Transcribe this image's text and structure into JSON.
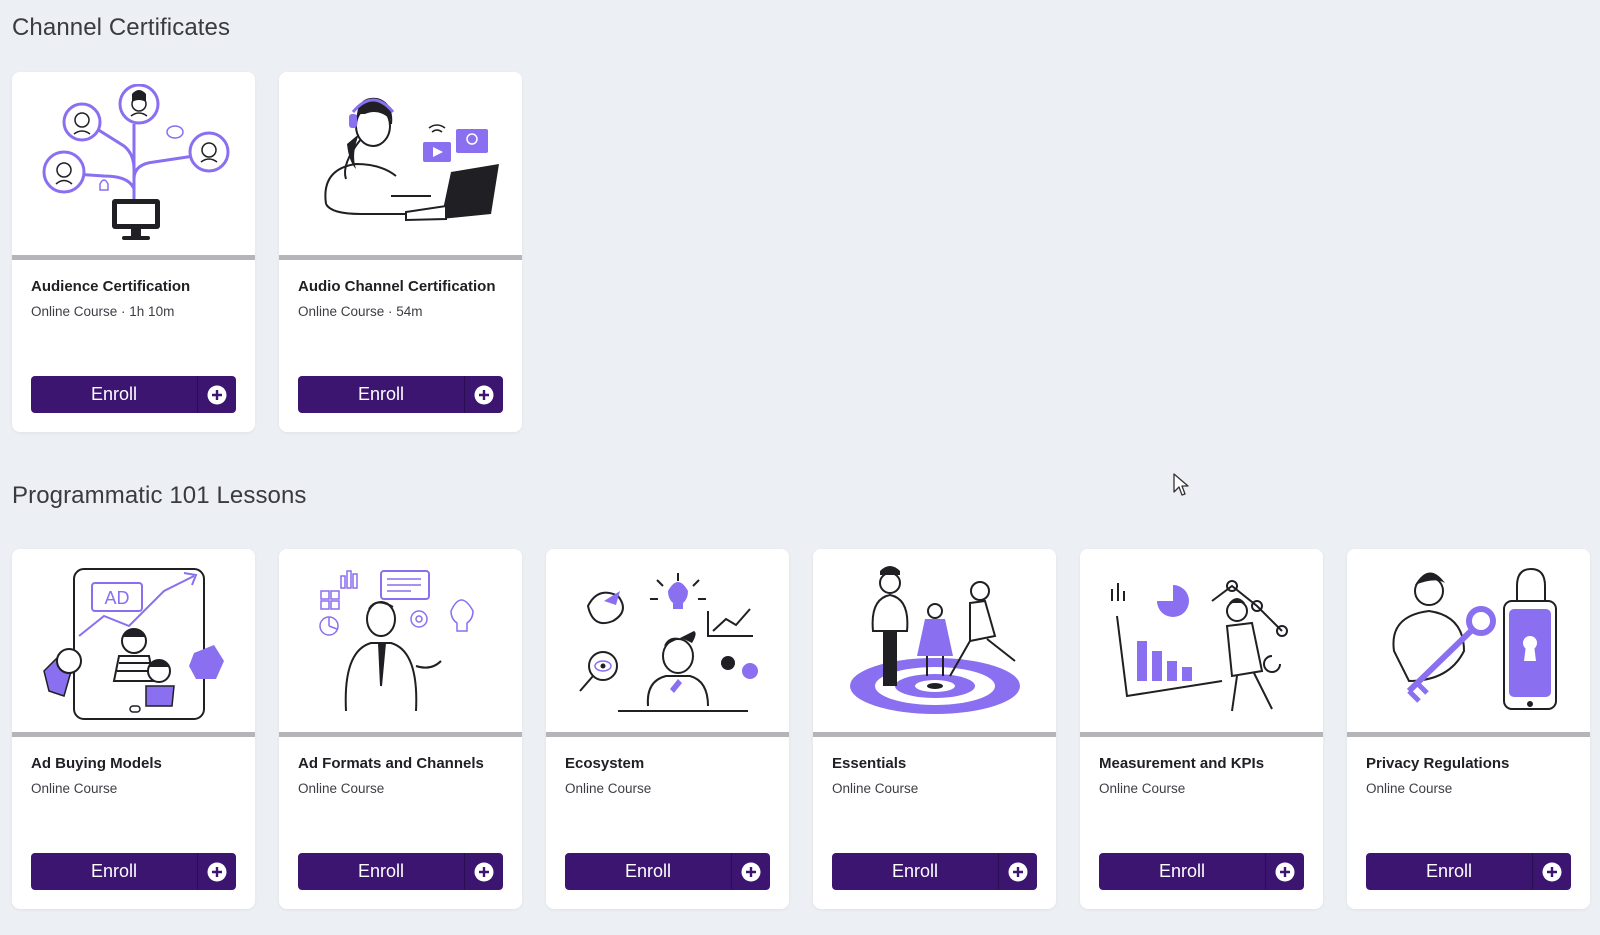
{
  "sections": [
    {
      "title": "Channel Certificates",
      "courses": [
        {
          "title": "Audience Certification",
          "meta": "Online Course  · 1h 10m",
          "enroll": "Enroll",
          "illustration": "audience-network-illustration"
        },
        {
          "title": "Audio Channel Certification",
          "meta": "Online Course  · 54m",
          "enroll": "Enroll",
          "illustration": "audio-headset-laptop-illustration"
        }
      ]
    },
    {
      "title": "Programmatic 101 Lessons",
      "courses": [
        {
          "title": "Ad Buying Models",
          "meta": "Online Course",
          "enroll": "Enroll",
          "illustration": "ad-tablet-illustration",
          "ad_text": "AD"
        },
        {
          "title": "Ad Formats and Channels",
          "meta": "Online Course",
          "enroll": "Enroll",
          "illustration": "businessman-ideas-illustration"
        },
        {
          "title": "Ecosystem",
          "meta": "Online Course",
          "enroll": "Enroll",
          "illustration": "thinking-person-illustration"
        },
        {
          "title": "Essentials",
          "meta": "Online Course",
          "enroll": "Enroll",
          "illustration": "target-people-illustration"
        },
        {
          "title": "Measurement and KPIs",
          "meta": "Online Course",
          "enroll": "Enroll",
          "illustration": "charts-analyst-illustration"
        },
        {
          "title": "Privacy Regulations",
          "meta": "Online Course",
          "enroll": "Enroll",
          "illustration": "key-lock-phone-illustration"
        }
      ]
    }
  ],
  "colors": {
    "accent": "#3b1570",
    "illustration_purple": "#8a6ff0",
    "background": "#eceff3"
  },
  "icons": {
    "enroll_plus": "plus-circle-icon",
    "cursor": "mouse-pointer-icon"
  }
}
